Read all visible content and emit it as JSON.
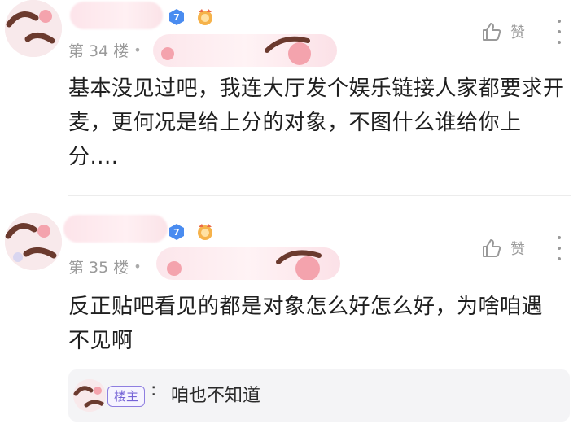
{
  "posts": [
    {
      "floor": "第 34 楼",
      "level": "7",
      "like_label": "赞",
      "content": "基本没见过吧，我连大厅发个娱乐链接人家都要求开麦，更何况是给上分的对象，不图什么谁给你上分...."
    },
    {
      "floor": "第 35 楼",
      "level": "7",
      "like_label": "赞",
      "content": "反正贴吧看见的都是对象怎么好怎么好，为啥咱遇不见啊",
      "reply": {
        "tag": "楼主",
        "colon": ":",
        "text": "咱也不知道"
      }
    }
  ],
  "colors": {
    "level_badge": "#4a8cf0",
    "medal": "#f2a23a",
    "op_tag": "#7563d6"
  },
  "icons": [
    "thumbs-up-icon",
    "more-vertical-icon",
    "level-badge-icon",
    "medal-icon"
  ]
}
